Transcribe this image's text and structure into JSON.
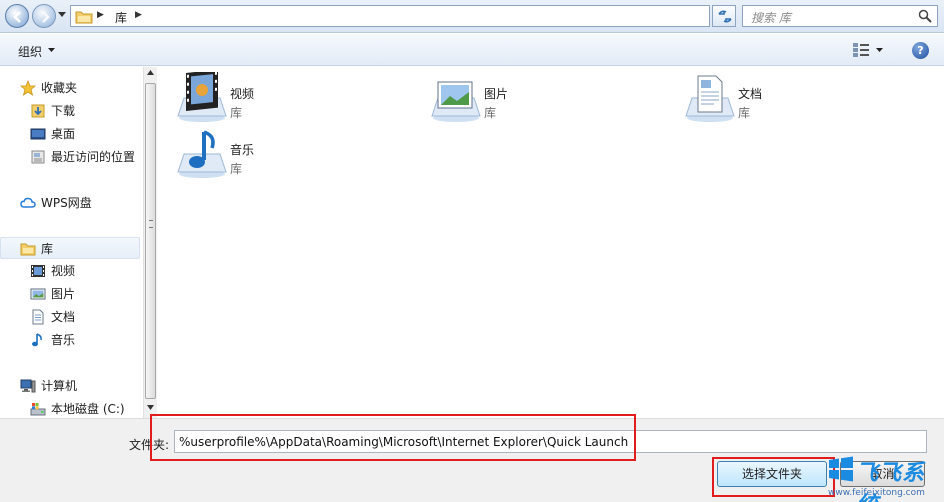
{
  "address_bar": {
    "breadcrumb": [
      "库"
    ],
    "search_placeholder": "搜索 库"
  },
  "toolbar": {
    "organize_label": "组织",
    "help_label": "?"
  },
  "nav": {
    "favorites": {
      "label": "收藏夹",
      "items": [
        "下载",
        "桌面",
        "最近访问的位置"
      ]
    },
    "wps": "WPS网盘",
    "libraries": {
      "label": "库",
      "items": [
        "视频",
        "图片",
        "文档",
        "音乐"
      ]
    },
    "computer": {
      "label": "计算机",
      "items": [
        "本地磁盘 (C:)"
      ]
    }
  },
  "content": {
    "libraries": [
      {
        "name": "视频",
        "type": "库",
        "icon": "video-library-icon"
      },
      {
        "name": "图片",
        "type": "库",
        "icon": "picture-library-icon"
      },
      {
        "name": "文档",
        "type": "库",
        "icon": "document-library-icon"
      },
      {
        "name": "音乐",
        "type": "库",
        "icon": "music-library-icon"
      }
    ]
  },
  "bottom": {
    "folder_label": "文件夹:",
    "folder_value": "%userprofile%\\AppData\\Roaming\\Microsoft\\Internet Explorer\\Quick Launch",
    "select_button": "选择文件夹",
    "cancel_button": "取消"
  },
  "watermark": {
    "name": "飞飞系统",
    "url": "www.feifeixitong.com"
  },
  "colors": {
    "highlight": "#e01c1c",
    "accent": "#1a8be0"
  }
}
